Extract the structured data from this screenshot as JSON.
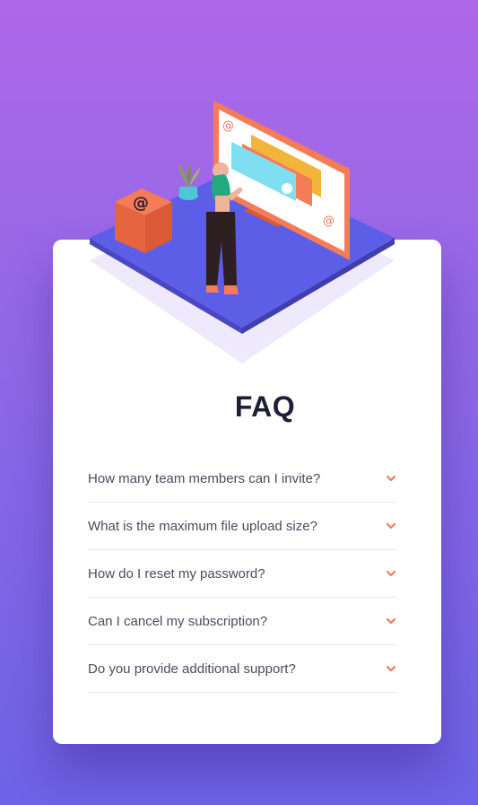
{
  "page": {
    "title": "FAQ"
  },
  "faq": {
    "items": [
      {
        "question": "How many team members can I invite?",
        "icon": "chevron-down-icon"
      },
      {
        "question": "What is the maximum file upload size?",
        "icon": "chevron-down-icon"
      },
      {
        "question": "How do I reset my password?",
        "icon": "chevron-down-icon"
      },
      {
        "question": "Can I cancel my subscription?",
        "icon": "chevron-down-icon"
      },
      {
        "question": "Do you provide additional support?",
        "icon": "chevron-down-icon"
      }
    ]
  },
  "colors": {
    "background_top": "#ae67e9",
    "background_bottom": "#6c63e6",
    "card": "#ffffff",
    "title": "#1e1f36",
    "question_text": "#4b4c5f",
    "accent": "#f47c57",
    "divider": "#e8e8ea"
  }
}
